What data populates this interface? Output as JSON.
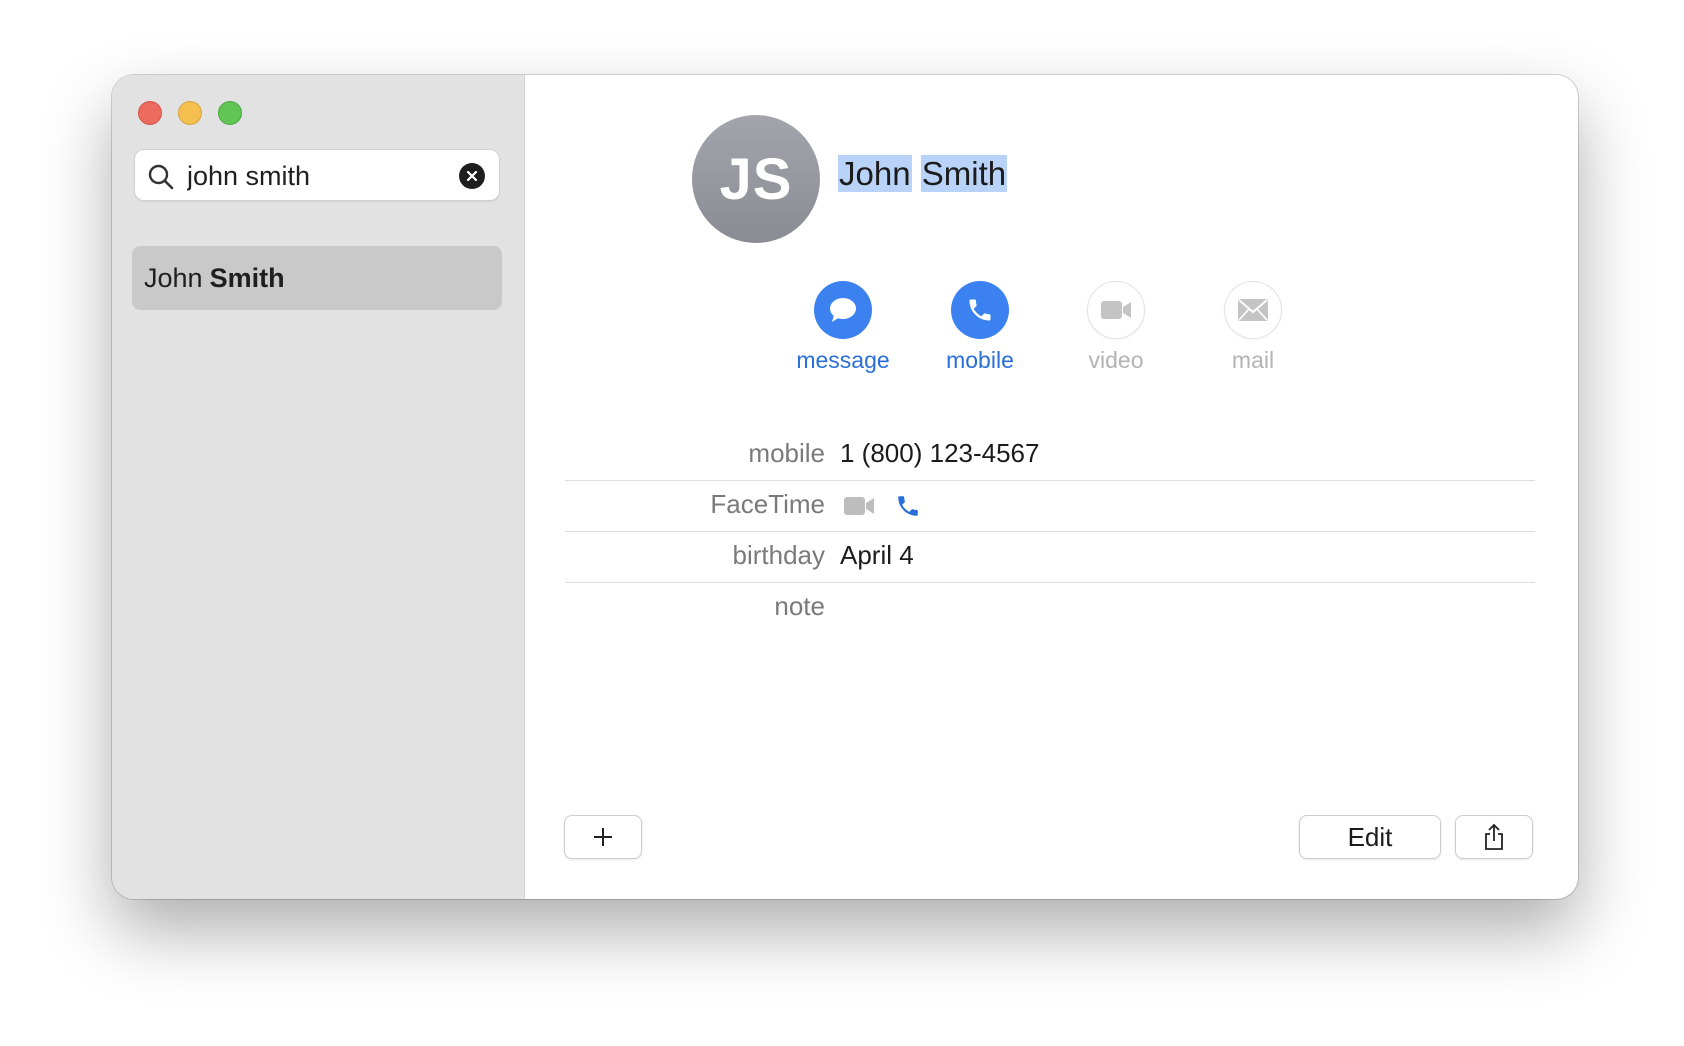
{
  "search": {
    "query": "john smith",
    "clear_label": "clear search"
  },
  "sidebar": {
    "results": [
      {
        "first": "John",
        "last": "Smith"
      }
    ]
  },
  "contact": {
    "initials": "JS",
    "first_name": "John",
    "last_name": "Smith",
    "actions": [
      {
        "label": "message",
        "icon": "message-bubble-icon",
        "enabled": true
      },
      {
        "label": "mobile",
        "icon": "phone-icon",
        "enabled": true
      },
      {
        "label": "video",
        "icon": "video-camera-icon",
        "enabled": false
      },
      {
        "label": "mail",
        "icon": "envelope-icon",
        "enabled": false
      }
    ],
    "fields": [
      {
        "label": "mobile",
        "value": "1 (800) 123-4567"
      },
      {
        "label": "FaceTime",
        "value": ""
      },
      {
        "label": "birthday",
        "value": "April 4"
      },
      {
        "label": "note",
        "value": ""
      }
    ]
  },
  "toolbar": {
    "add_label": "+",
    "edit_label": "Edit"
  },
  "colors": {
    "accent": "#3b82f0",
    "sidebar_bg": "#e2e2e2",
    "selection": "#c9c9c9",
    "text_highlight": "#b8d3f7"
  }
}
